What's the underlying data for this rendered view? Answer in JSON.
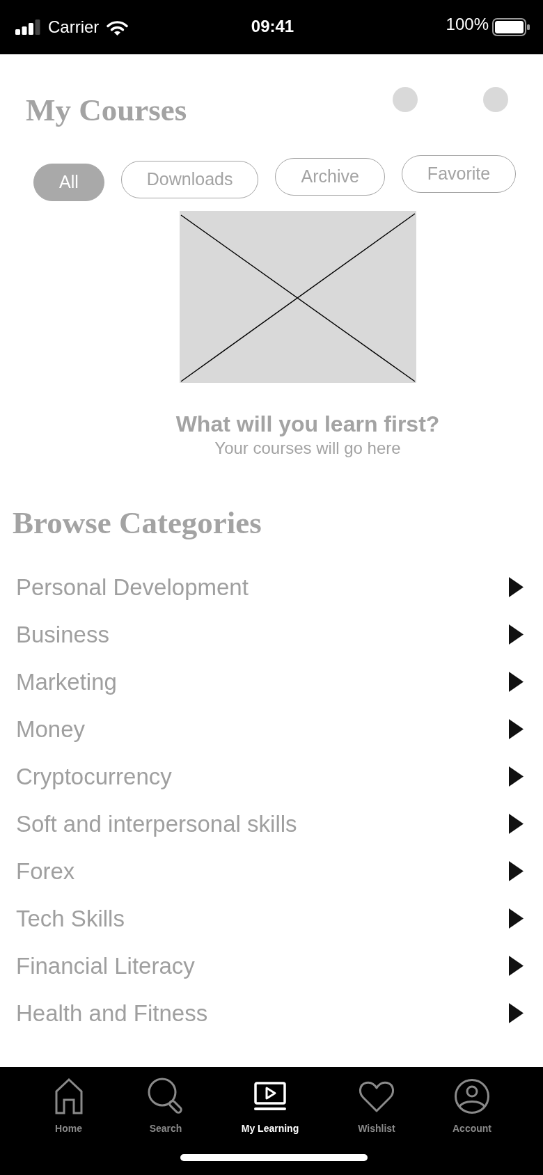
{
  "status_bar": {
    "carrier": "Carrier",
    "time": "09:41",
    "battery": "100%"
  },
  "header": {
    "title": "My Courses"
  },
  "filters": [
    {
      "label": "All",
      "selected": true
    },
    {
      "label": "Downloads",
      "selected": false
    },
    {
      "label": "Archive",
      "selected": false
    },
    {
      "label": "Favorite",
      "selected": false
    }
  ],
  "empty_state": {
    "title": "What will you learn first?",
    "subtitle": "Your courses will go here"
  },
  "categories": {
    "title": "Browse Categories",
    "items": [
      "Personal Development",
      "Business",
      "Marketing",
      "Money",
      "Cryptocurrency",
      "Soft and interpersonal skills",
      "Forex",
      "Tech Skills",
      "Financial Literacy",
      "Health and Fitness"
    ]
  },
  "tab_bar": {
    "tabs": [
      {
        "label": "Home",
        "kind": "home",
        "selected": false
      },
      {
        "label": "Search",
        "kind": "search",
        "selected": false
      },
      {
        "label": "My Learning",
        "kind": "learning",
        "selected": true
      },
      {
        "label": "Wishlist",
        "kind": "wishlist",
        "selected": false
      },
      {
        "label": "Account",
        "kind": "account",
        "selected": false
      }
    ]
  }
}
